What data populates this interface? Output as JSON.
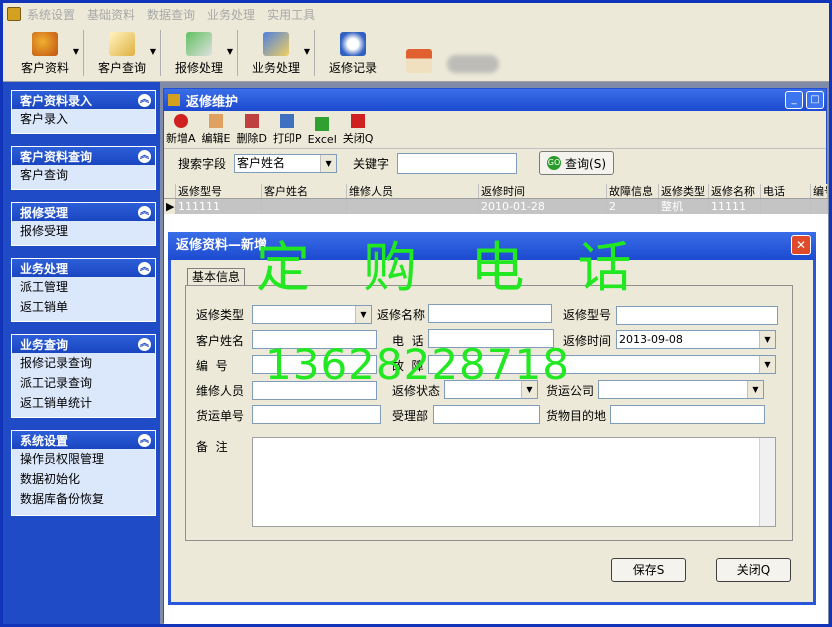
{
  "menubar": {
    "items": [
      "系统设置",
      "基础资料",
      "数据查询",
      "业务处理",
      "实用工具"
    ]
  },
  "toolbar": {
    "buttons": [
      "客户资料",
      "客户查询",
      "报修处理",
      "业务处理",
      "返修记录"
    ]
  },
  "sidebar": {
    "groups": [
      {
        "title": "客户资料录入",
        "items": [
          "客户录入"
        ]
      },
      {
        "title": "客户资料查询",
        "items": [
          "客户查询"
        ]
      },
      {
        "title": "报修受理",
        "items": [
          "报修受理"
        ]
      },
      {
        "title": "业务处理",
        "items": [
          "派工管理",
          "返工销单"
        ]
      },
      {
        "title": "业务查询",
        "items": [
          "报修记录查询",
          "派工记录查询",
          "返工销单统计"
        ]
      },
      {
        "title": "系统设置",
        "items": [
          "操作员权限管理",
          "数据初始化",
          "数据库备份恢复"
        ]
      }
    ]
  },
  "child_window": {
    "title": "返修维护",
    "tools": [
      "新增A",
      "编辑E",
      "删除D",
      "打印P",
      "Excel",
      "关闭Q"
    ],
    "search": {
      "field_label": "搜索字段",
      "field_value": "客户姓名",
      "keyword_label": "关键字",
      "keyword_value": "",
      "query_button": "查询(S)"
    },
    "grid": {
      "columns": [
        "返修型号",
        "客户姓名",
        "维修人员",
        "返修时间",
        "故障信息",
        "返修类型",
        "返修名称",
        "电话",
        "编号"
      ],
      "rows": [
        [
          "111111",
          "",
          "",
          "2010-01-28",
          "2",
          "整机",
          "11111",
          "",
          ""
        ]
      ]
    }
  },
  "dialog": {
    "title": "返修资料—新增",
    "tab": "基本信息",
    "labels": {
      "repair_type": "返修类型",
      "repair_name": "返修名称",
      "repair_model": "返修型号",
      "customer_name": "客户姓名",
      "phone": "电  话",
      "repair_time": "返修时间",
      "number": "编  号",
      "fault": "故  障",
      "technician": "维修人员",
      "repair_status": "返修状态",
      "shipping_company": "货运公司",
      "shipping_no": "货运单号",
      "receiving_dept": "受理部",
      "destination": "货物目的地",
      "notes": "备  注"
    },
    "values": {
      "repair_time": "2013-09-08"
    },
    "buttons": {
      "save": "保存S",
      "close": "关闭Q"
    }
  },
  "watermark": {
    "line1": "定 购 电 话",
    "line2": "13628228718"
  }
}
